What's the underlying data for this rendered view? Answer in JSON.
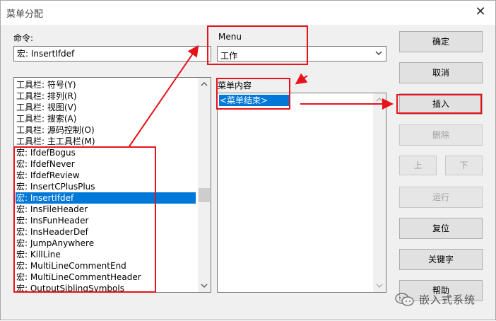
{
  "window": {
    "title": "菜单分配",
    "close_glyph": "✕"
  },
  "command": {
    "label": "命令:",
    "value": "宏: InsertIfdef",
    "items": [
      "工具栏: 符号(Y)",
      "工具栏: 排列(R)",
      "工具栏: 视图(V)",
      "工具栏: 搜索(A)",
      "工具栏: 源码控制(O)",
      "工具栏: 主工具栏(M)",
      "宏: IfdefBogus",
      "宏: IfdefNever",
      "宏: IfdefReview",
      "宏: InsertCPlusPlus",
      "宏: InsertIfdef",
      "宏: InsFileHeader",
      "宏: InsFunHeader",
      "宏: InsHeaderDef",
      "宏: JumpAnywhere",
      "宏: KillLine",
      "宏: MultiLineCommentEnd",
      "宏: MultiLineCommentHeader",
      "宏: OutputSiblingSymbols"
    ],
    "selected_index": 10
  },
  "menu": {
    "label": "Menu",
    "selected": "工作"
  },
  "menu_contents": {
    "label": "菜单内容",
    "items": [
      "<菜单结束>"
    ],
    "selected_index": 0
  },
  "buttons": {
    "ok": "确定",
    "cancel": "取消",
    "insert": "插入",
    "delete": "删除",
    "up": "上",
    "down": "下",
    "run": "运行",
    "reset": "复位",
    "keys": "关键字",
    "help": "帮助"
  },
  "watermark": {
    "text": "嵌入式系统"
  },
  "colors": {
    "annotation_red": "#e8121b",
    "selection_blue": "#0078d7",
    "dialog_bg": "#f0f0f0"
  }
}
